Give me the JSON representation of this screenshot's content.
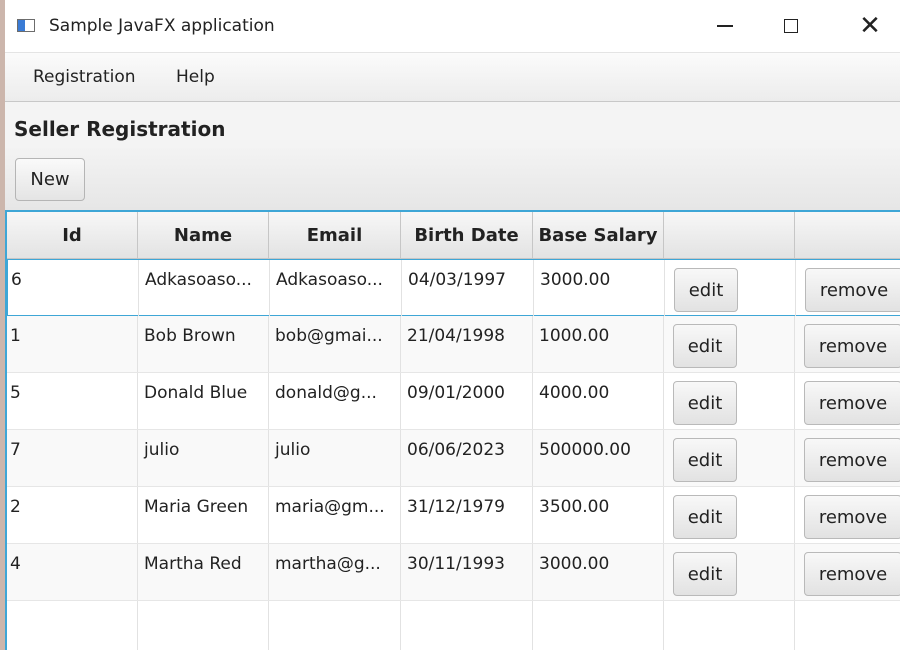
{
  "window": {
    "title": "Sample JavaFX application"
  },
  "menu": {
    "items": [
      "Registration",
      "Help"
    ]
  },
  "page": {
    "title": "Seller Registration",
    "new_button": "New"
  },
  "table": {
    "columns": [
      "Id",
      "Name",
      "Email",
      "Birth Date",
      "Base Salary",
      "",
      ""
    ],
    "rows": [
      {
        "id": "6",
        "name": "Adkasoaso...",
        "email": "Adkasoaso...",
        "birth": "04/03/1997",
        "salary": "3000.00",
        "edit": "edit",
        "remove": "remove"
      },
      {
        "id": "1",
        "name": "Bob Brown",
        "email": "bob@gmai...",
        "birth": "21/04/1998",
        "salary": "1000.00",
        "edit": "edit",
        "remove": "remove"
      },
      {
        "id": "5",
        "name": "Donald Blue",
        "email": "donald@g...",
        "birth": "09/01/2000",
        "salary": "4000.00",
        "edit": "edit",
        "remove": "remove"
      },
      {
        "id": "7",
        "name": "julio",
        "email": "julio",
        "birth": "06/06/2023",
        "salary": "500000.00",
        "edit": "edit",
        "remove": "remove"
      },
      {
        "id": "2",
        "name": "Maria Green",
        "email": "maria@gm...",
        "birth": "31/12/1979",
        "salary": "3500.00",
        "edit": "edit",
        "remove": "remove"
      },
      {
        "id": "4",
        "name": "Martha Red",
        "email": "martha@g...",
        "birth": "30/11/1993",
        "salary": "3000.00",
        "edit": "edit",
        "remove": "remove"
      }
    ]
  },
  "colors": {
    "selection_border": "#3ea6d6",
    "desktop": "#ccb6ac"
  }
}
